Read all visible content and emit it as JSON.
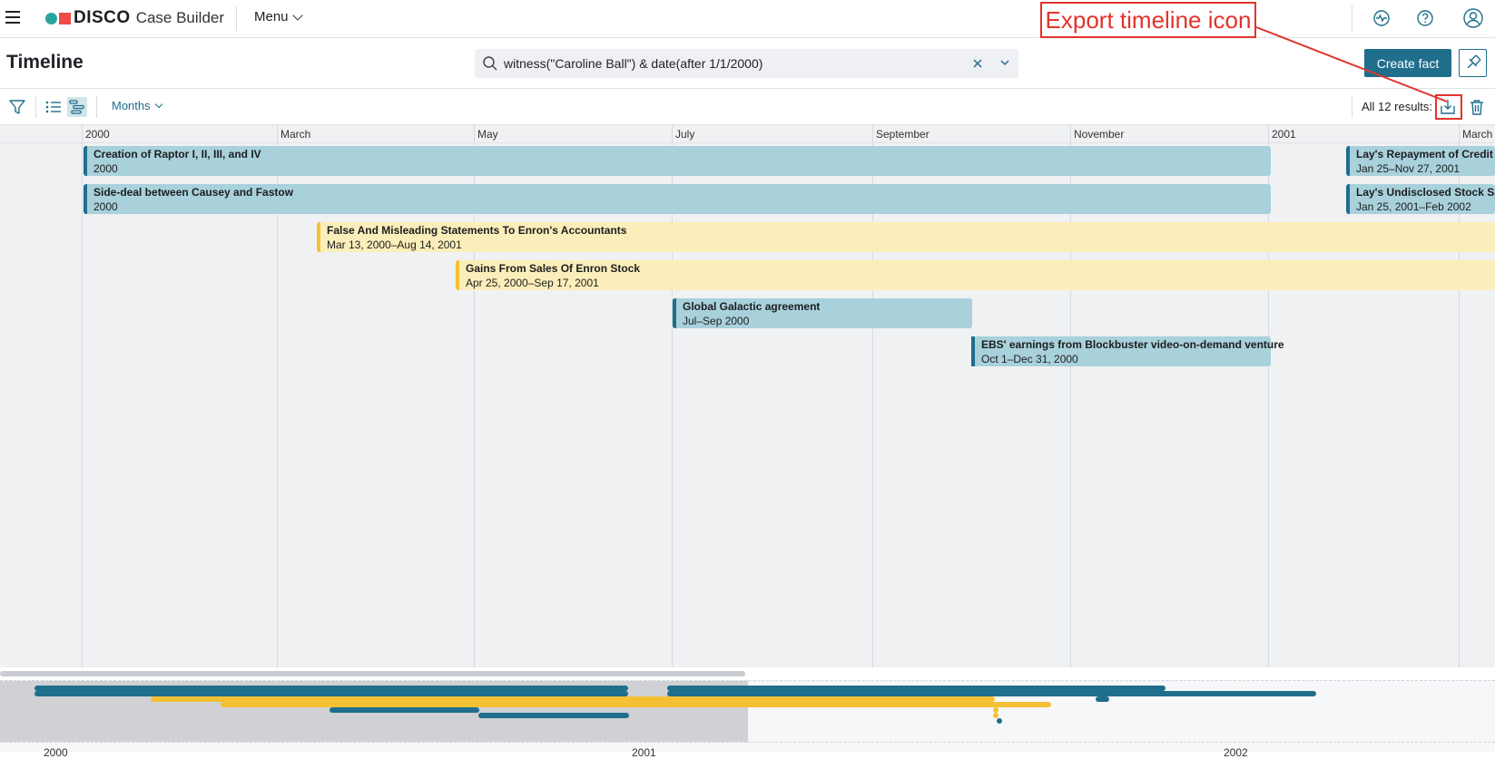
{
  "app": {
    "brand": "DISCO",
    "product": "Case Builder",
    "menu_label": "Menu",
    "icons": [
      "hamburger-icon",
      "activity-icon",
      "help-icon",
      "user-icon"
    ]
  },
  "page": {
    "title": "Timeline",
    "search_value": "witness(\"Caroline Ball\") & date(after 1/1/2000)",
    "create_label": "Create fact"
  },
  "toolbar": {
    "zoom_label": "Months",
    "results_label": "All 12 results:"
  },
  "timeline": {
    "axis_labels": [
      "2000",
      "March",
      "May",
      "July",
      "September",
      "November",
      "2001",
      "March"
    ],
    "facts": [
      {
        "title": "Creation of Raptor I, II, III, and IV",
        "date": "2000",
        "color": "blue"
      },
      {
        "title": "Side-deal between Causey and Fastow",
        "date": "2000",
        "color": "blue"
      },
      {
        "title": "False And Misleading Statements To Enron's Accountants",
        "date": "Mar 13, 2000–Aug 14, 2001",
        "color": "yellow"
      },
      {
        "title": "Gains From Sales Of Enron Stock",
        "date": "Apr 25, 2000–Sep 17, 2001",
        "color": "yellow"
      },
      {
        "title": "Global Galactic agreement",
        "date": "Jul–Sep 2000",
        "color": "blue"
      },
      {
        "title": "EBS' earnings from Blockbuster video-on-demand venture",
        "date": "Oct 1–Dec 31, 2000",
        "color": "blue"
      },
      {
        "title": "Lay's Repayment of Credit",
        "date": "Jan 25–Nov 27, 2001",
        "color": "blue"
      },
      {
        "title": "Lay's Undisclosed Stock Sa",
        "date": "Jan 25, 2001–Feb 2002",
        "color": "blue"
      }
    ]
  },
  "overview": {
    "labels": [
      "2000",
      "2001",
      "2002"
    ]
  },
  "annotation": {
    "label": "Export timeline icon"
  },
  "colors": {
    "primary": "#1f6e8c",
    "bar_blue": "#a8d1db",
    "bar_yellow": "#fbeeba",
    "accent_yellow": "#f4c034",
    "annotation_red": "#e2332b"
  }
}
